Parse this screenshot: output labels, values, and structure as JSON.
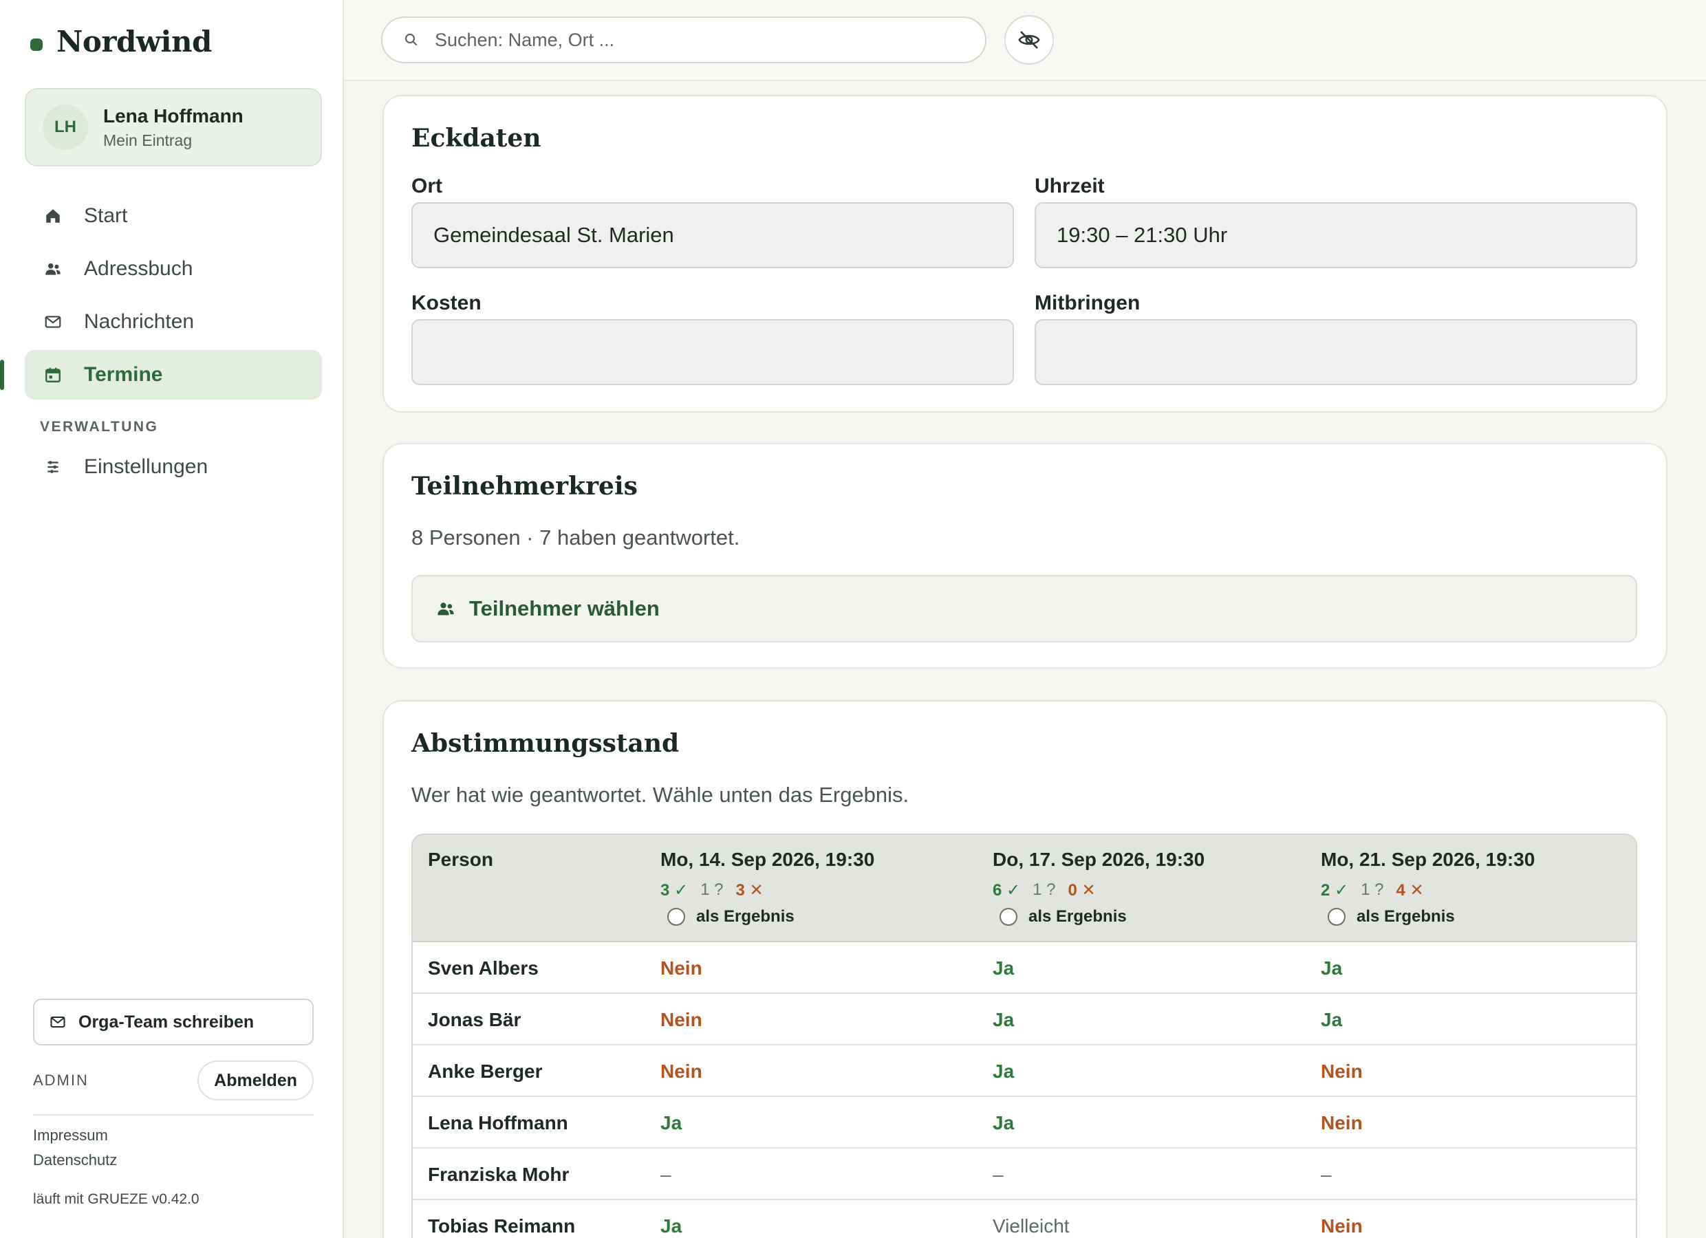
{
  "brand": {
    "name": "Nordwind"
  },
  "user": {
    "initials": "LH",
    "name": "Lena Hoffmann",
    "subtitle": "Mein Eintrag"
  },
  "nav": {
    "items": [
      {
        "label": "Start",
        "icon": "home-icon"
      },
      {
        "label": "Adressbuch",
        "icon": "people-icon"
      },
      {
        "label": "Nachrichten",
        "icon": "mail-icon"
      },
      {
        "label": "Termine",
        "icon": "calendar-icon",
        "active": true
      }
    ],
    "section_label": "VERWALTUNG",
    "settings_label": "Einstellungen"
  },
  "sidebar_footer": {
    "write_button": "Orga-Team schreiben",
    "admin_label": "ADMIN",
    "logout_button": "Abmelden",
    "impressum": "Impressum",
    "datenschutz": "Datenschutz",
    "version": "läuft mit GRUEZE v0.42.0"
  },
  "topbar": {
    "search_placeholder": "Suchen: Name, Ort ..."
  },
  "eckdaten": {
    "title": "Eckdaten",
    "ort_label": "Ort",
    "ort_value": "Gemeindesaal St. Marien",
    "uhrzeit_label": "Uhrzeit",
    "uhrzeit_value": "19:30 – 21:30 Uhr",
    "kosten_label": "Kosten",
    "kosten_value": "",
    "mitbringen_label": "Mitbringen",
    "mitbringen_value": ""
  },
  "teilnehmer": {
    "title": "Teilnehmerkreis",
    "summary": "8 Personen · 7 haben geantwortet.",
    "choose_button": "Teilnehmer wählen"
  },
  "abstimmung": {
    "title": "Abstimmungsstand",
    "subtitle": "Wer hat wie geantwortet. Wähle unten das Ergebnis.",
    "person_header": "Person",
    "result_label": "als Ergebnis",
    "dates": [
      {
        "label": "Mo, 14. Sep 2026, 19:30",
        "yes": "3 ✓",
        "maybe": "1 ?",
        "no": "3 ✕"
      },
      {
        "label": "Do, 17. Sep 2026, 19:30",
        "yes": "6 ✓",
        "maybe": "1 ?",
        "no": "0 ✕"
      },
      {
        "label": "Mo, 21. Sep 2026, 19:30",
        "yes": "2 ✓",
        "maybe": "1 ?",
        "no": "4 ✕"
      }
    ],
    "rows": [
      {
        "person": "Sven Albers",
        "answers": [
          "Nein",
          "Ja",
          "Ja"
        ]
      },
      {
        "person": "Jonas Bär",
        "answers": [
          "Nein",
          "Ja",
          "Ja"
        ]
      },
      {
        "person": "Anke Berger",
        "answers": [
          "Nein",
          "Ja",
          "Nein"
        ]
      },
      {
        "person": "Lena Hoffmann",
        "answers": [
          "Ja",
          "Ja",
          "Nein"
        ]
      },
      {
        "person": "Franziska Mohr",
        "answers": [
          "–",
          "–",
          "–"
        ]
      },
      {
        "person": "Tobias Reimann",
        "answers": [
          "Ja",
          "Vielleicht",
          "Nein"
        ]
      }
    ]
  },
  "colors": {
    "accent": "#2f6a3c",
    "yes": "#2e7a3a",
    "no": "#b4531f"
  }
}
